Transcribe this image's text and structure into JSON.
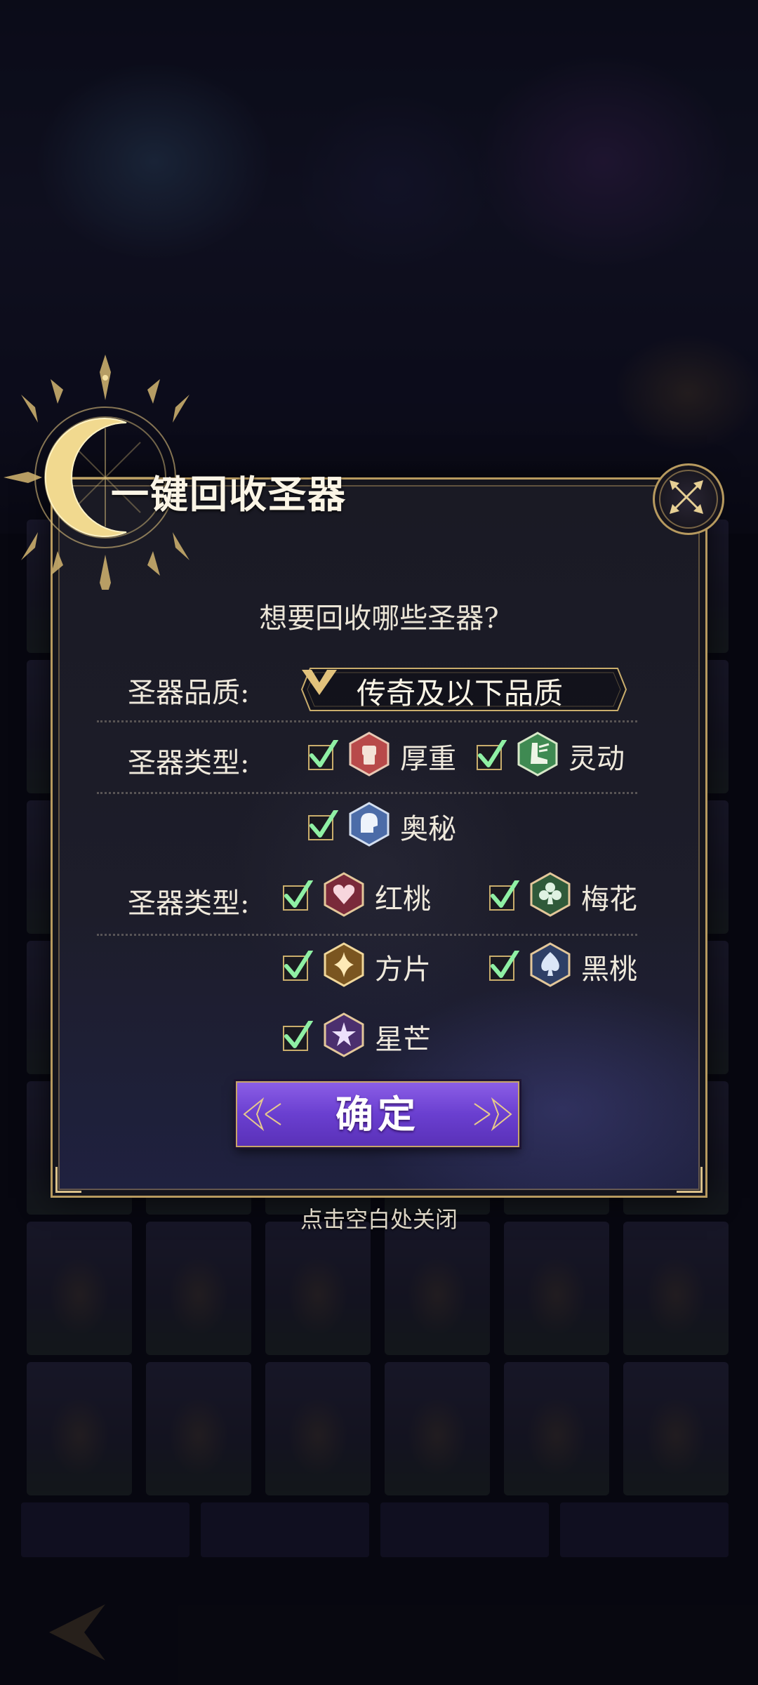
{
  "dialog": {
    "title": "一键回收圣器",
    "prompt": "想要回收哪些圣器?",
    "quality": {
      "label": "圣器品质:",
      "value": "传奇及以下品质"
    },
    "attribute_filter": {
      "label": "圣器类型:",
      "options": [
        {
          "label": "厚重",
          "icon": "fist-icon",
          "checked": true
        },
        {
          "label": "灵动",
          "icon": "winged-boot-icon",
          "checked": true
        },
        {
          "label": "奥秘",
          "icon": "mind-icon",
          "checked": true
        }
      ]
    },
    "suit_filter": {
      "label": "圣器类型:",
      "options": [
        {
          "label": "红桃",
          "icon": "heart-icon",
          "checked": true
        },
        {
          "label": "梅花",
          "icon": "club-icon",
          "checked": true
        },
        {
          "label": "方片",
          "icon": "diamond-icon",
          "checked": true
        },
        {
          "label": "黑桃",
          "icon": "spade-icon",
          "checked": true
        },
        {
          "label": "星芒",
          "icon": "star-icon",
          "checked": true
        }
      ]
    },
    "confirm_label": "确定",
    "dismiss_hint": "点击空白处关闭"
  },
  "colors": {
    "gold": "#b79a5f",
    "check_green": "#8ff0a4",
    "button_purple": "#6a3fd0",
    "strength_red": "#b84a4a",
    "agility_green": "#3f8a52",
    "arcane_blue": "#4c6ca8"
  }
}
